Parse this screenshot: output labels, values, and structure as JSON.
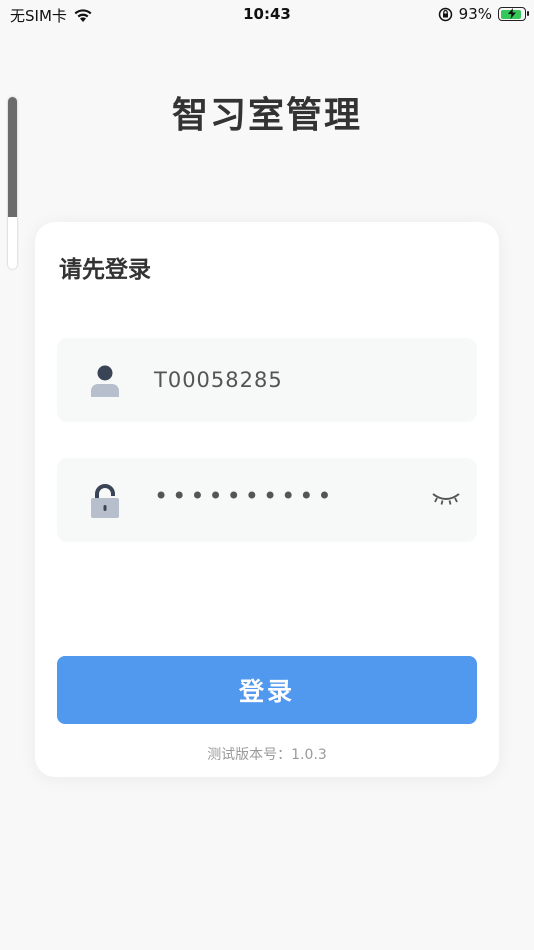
{
  "status_bar": {
    "carrier": "无SIM卡",
    "time": "10:43",
    "battery_percent": "93%",
    "battery_level": 0.93,
    "icons": [
      "wifi-icon",
      "orientation-lock-icon",
      "battery-charging-icon"
    ]
  },
  "app": {
    "title": "智习室管理"
  },
  "login_card": {
    "title": "请先登录",
    "username": {
      "value": "T00058285",
      "icon": "user-icon"
    },
    "password": {
      "masked_value": "••••••••••",
      "icon": "lock-icon",
      "toggle_icon": "eye-closed-icon"
    },
    "login_button": "登录",
    "version_text": "测试版本号：1.0.3"
  },
  "colors": {
    "accent": "#5099ee",
    "icon_dark": "#394556",
    "icon_light": "#b7bfcc",
    "field_bg": "#f7f8f8"
  }
}
